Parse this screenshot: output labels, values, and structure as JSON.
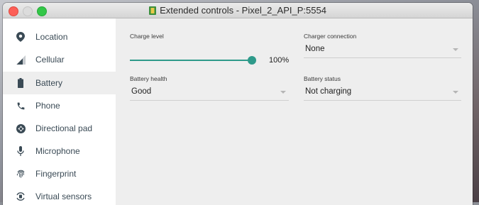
{
  "window": {
    "title": "Extended controls - Pixel_2_API_P:5554"
  },
  "sidebar": {
    "items": [
      {
        "label": "Location",
        "icon": "location-pin-icon",
        "selected": false
      },
      {
        "label": "Cellular",
        "icon": "signal-icon",
        "selected": false
      },
      {
        "label": "Battery",
        "icon": "battery-icon",
        "selected": true
      },
      {
        "label": "Phone",
        "icon": "phone-icon",
        "selected": false
      },
      {
        "label": "Directional pad",
        "icon": "dpad-icon",
        "selected": false
      },
      {
        "label": "Microphone",
        "icon": "microphone-icon",
        "selected": false
      },
      {
        "label": "Fingerprint",
        "icon": "fingerprint-icon",
        "selected": false
      },
      {
        "label": "Virtual sensors",
        "icon": "rotate-sensor-icon",
        "selected": false
      }
    ]
  },
  "battery": {
    "charge_level_label": "Charge level",
    "charge_level_value": "100%",
    "charge_level_fraction": 1.0,
    "charger_connection_label": "Charger connection",
    "charger_connection_value": "None",
    "battery_health_label": "Battery health",
    "battery_health_value": "Good",
    "battery_status_label": "Battery status",
    "battery_status_value": "Not charging"
  },
  "colors": {
    "accent": "#2e9a8a",
    "icon": "#3a4a55"
  }
}
